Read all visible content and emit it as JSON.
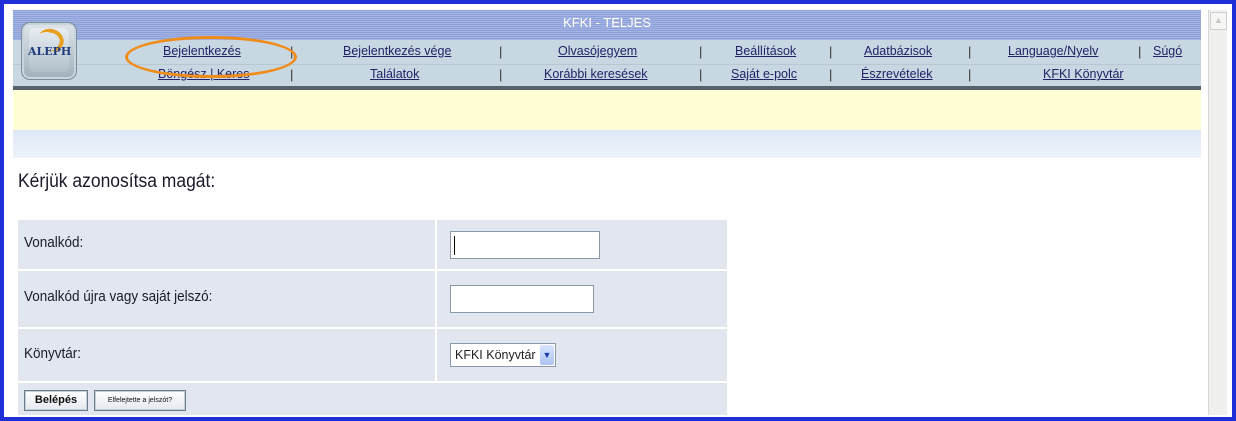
{
  "app": {
    "title": "KFKI - TELJES",
    "logo_text": "ALEPH"
  },
  "nav": {
    "row1": [
      "Bejelentkezés",
      "Bejelentkezés vége",
      "Olvasójegyem",
      "Beállítások",
      "Adatbázisok",
      "Language/Nyelv",
      "Súgó"
    ],
    "row2": [
      "Böngész | Keres",
      "Találatok",
      "Korábbi keresések",
      "Saját e-polc",
      "Észrevételek",
      "KFKI Könyvtár"
    ],
    "separator": "|"
  },
  "page": {
    "heading": "Kérjük azonosítsa magát:"
  },
  "form": {
    "barcode_label": "Vonalkód:",
    "barcode_value": "",
    "password_label": "Vonalkód újra vagy saját jelszó:",
    "password_value": "",
    "library_label": "Könyvtár:",
    "library_selected": "KFKI Könyvtár",
    "login_button": "Belépés",
    "forgot_button": "Elfelejtette a jelszót?"
  },
  "colors": {
    "frame_border": "#1f2fd8",
    "highlight": "#f08c1a",
    "title_bar": "#8da0d8",
    "nav_bg": "#c8d8e3",
    "yellow_band": "#fffdd5",
    "form_row": "#e2e7ef"
  },
  "icons": {
    "scroll_up": "chevron-up-icon",
    "select_arrow": "chevron-down-icon",
    "logo": "aleph-logo-icon"
  }
}
